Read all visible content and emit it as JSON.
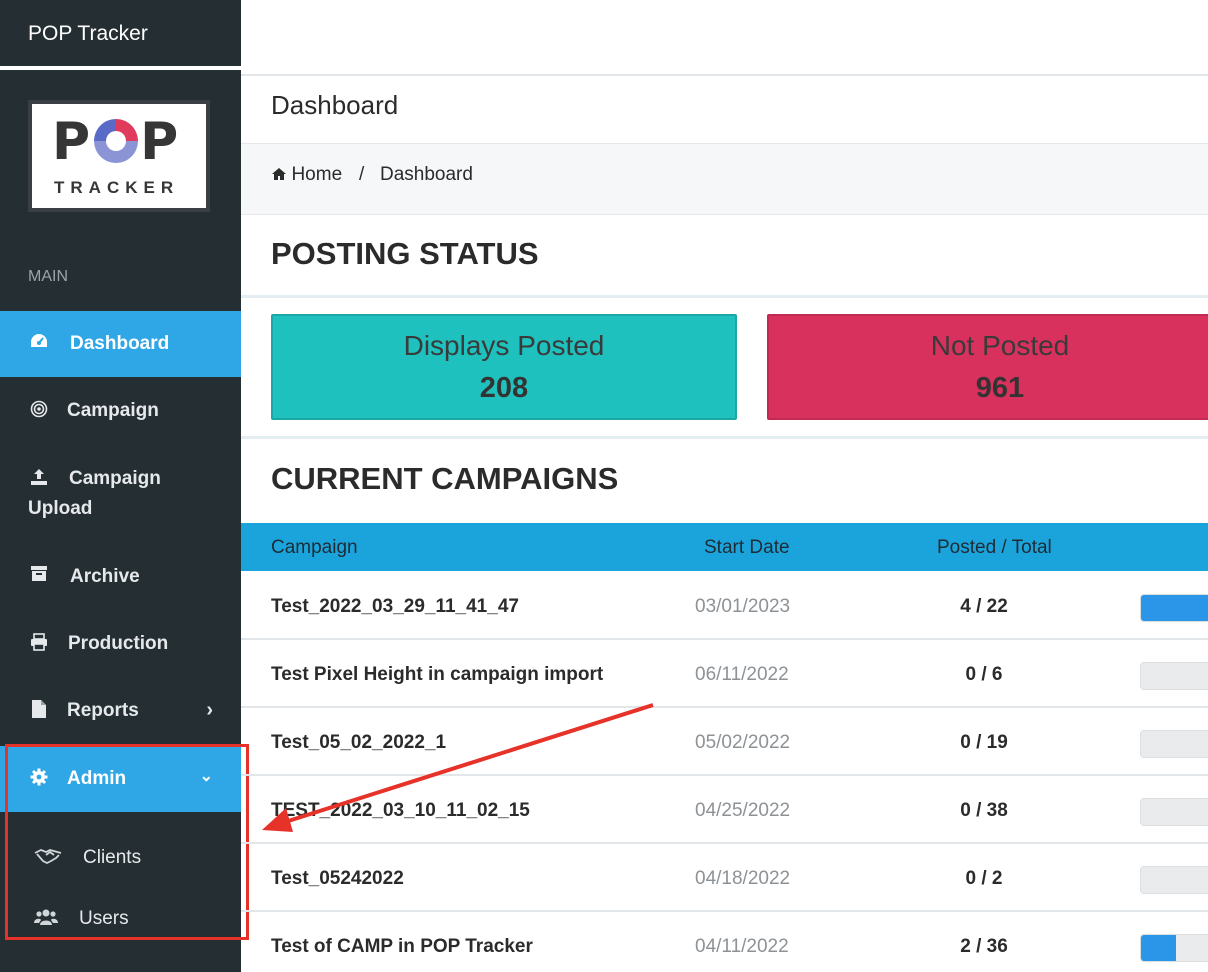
{
  "app": {
    "title": "POP Tracker",
    "logo_top": "P",
    "logo_bottom": "P",
    "logo_tracker": "TRACKER"
  },
  "sidebar": {
    "section_label": "MAIN",
    "items": [
      {
        "label": "Dashboard",
        "icon": "dashboard-gauge-icon",
        "active": true
      },
      {
        "label": "Campaign",
        "icon": "target-icon"
      },
      {
        "label": "Campaign",
        "label2": "Upload",
        "icon": "upload-icon"
      },
      {
        "label": "Archive",
        "icon": "archive-box-icon"
      },
      {
        "label": "Production",
        "icon": "printer-icon"
      },
      {
        "label": "Reports",
        "icon": "file-icon",
        "chevron": "›"
      },
      {
        "label": "Admin",
        "icon": "gear-icon",
        "chevron": "⌄",
        "active": true
      }
    ],
    "sub_items": [
      {
        "label": "Clients",
        "icon": "handshake-icon"
      },
      {
        "label": "Users",
        "icon": "users-icon"
      }
    ]
  },
  "header": {
    "page_title": "Dashboard",
    "breadcrumb": {
      "home": "Home",
      "separator": "/",
      "current": "Dashboard"
    }
  },
  "posting_status": {
    "heading": "POSTING STATUS",
    "cards": [
      {
        "label": "Displays Posted",
        "value": "208",
        "color": "#1fc1be"
      },
      {
        "label": "Not Posted",
        "value": "961",
        "color": "#d9315d"
      }
    ]
  },
  "campaigns": {
    "heading": "CURRENT CAMPAIGNS",
    "columns": [
      "Campaign",
      "Start Date",
      "Posted / Total"
    ],
    "rows": [
      {
        "name": "Test_2022_03_29_11_41_47",
        "start": "03/01/2023",
        "ratio": "4 / 22",
        "progress": 1.0
      },
      {
        "name": "Test Pixel Height in campaign import",
        "start": "06/11/2022",
        "ratio": "0 / 6",
        "progress": 0
      },
      {
        "name": "Test_05_02_2022_1",
        "start": "05/02/2022",
        "ratio": "0 / 19",
        "progress": 0
      },
      {
        "name": "TEST_2022_03_10_11_02_15",
        "start": "04/25/2022",
        "ratio": "0 / 38",
        "progress": 0
      },
      {
        "name": "Test_05242022",
        "start": "04/18/2022",
        "ratio": "0 / 2",
        "progress": 0
      },
      {
        "name": "Test of CAMP in POP Tracker",
        "start": "04/11/2022",
        "ratio": "2 / 36",
        "progress": 0.45
      }
    ]
  },
  "annotation": {
    "highlight_color": "#e63228"
  }
}
